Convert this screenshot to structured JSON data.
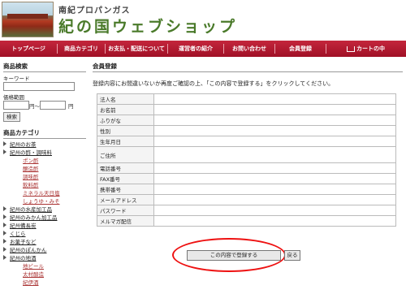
{
  "header": {
    "company": "南紀プロパンガス",
    "shop_name": "紀の国ウェブショップ"
  },
  "nav": [
    {
      "label": "トップページ"
    },
    {
      "label": "商品カテゴリ"
    },
    {
      "label": "お支払・配送について"
    },
    {
      "label": "運営者の紹介"
    },
    {
      "label": "お問い合わせ"
    },
    {
      "label": "会員登録"
    },
    {
      "label": "カートの中"
    }
  ],
  "search": {
    "title": "商品検索",
    "keyword_label": "キーワード",
    "keyword_value": "",
    "price_label": "価格範囲",
    "price_from": "",
    "price_sep": "円〜",
    "price_to": "",
    "price_unit": "円",
    "button": "検索"
  },
  "categories": {
    "title": "商品カテゴリ",
    "items": [
      {
        "label": "紀州のお茶",
        "sub": false
      },
      {
        "label": "紀州の酢・調味料",
        "sub": false
      },
      {
        "label": "ポン酢",
        "sub": true
      },
      {
        "label": "醸造酢",
        "sub": true
      },
      {
        "label": "調味酢",
        "sub": true
      },
      {
        "label": "飲料酢",
        "sub": true
      },
      {
        "label": "ミネラル天日塩",
        "sub": true
      },
      {
        "label": "しょうゆ・みそ",
        "sub": true
      },
      {
        "label": "紀州の水産加工品",
        "sub": false
      },
      {
        "label": "紀州のみかん加工品",
        "sub": false
      },
      {
        "label": "紀州備長炭",
        "sub": false
      },
      {
        "label": "くじら",
        "sub": false
      },
      {
        "label": "お菓子など",
        "sub": false
      },
      {
        "label": "紀州のぽんかん",
        "sub": false
      },
      {
        "label": "紀州の地酒",
        "sub": false
      },
      {
        "label": "地ビール",
        "sub": true
      },
      {
        "label": "太村酸造",
        "sub": true
      },
      {
        "label": "紀伊酒",
        "sub": true
      }
    ]
  },
  "main": {
    "title": "会員登録",
    "notice": "登録内容にお間違いないか再度ご確認の上、「この内容で登録する」をクリックしてください。",
    "fields": [
      {
        "label": "法人名",
        "value": ""
      },
      {
        "label": "お名前",
        "value": ""
      },
      {
        "label": "ふりがな",
        "value": ""
      },
      {
        "label": "性別",
        "value": ""
      },
      {
        "label": "生年月日",
        "value": ""
      },
      {
        "label": "ご住所",
        "value": ""
      },
      {
        "label": "電話番号",
        "value": ""
      },
      {
        "label": "FAX番号",
        "value": ""
      },
      {
        "label": "携帯番号",
        "value": ""
      },
      {
        "label": "メールアドレス",
        "value": ""
      },
      {
        "label": "パスワード",
        "value": ""
      },
      {
        "label": "メルマガ配信",
        "value": ""
      }
    ],
    "submit_label": "この内容で登録する",
    "back_label": "戻る"
  },
  "colors": {
    "nav": "#b01830",
    "highlight_ring": "#ee1111",
    "shop_name": "#4a7a2a"
  }
}
